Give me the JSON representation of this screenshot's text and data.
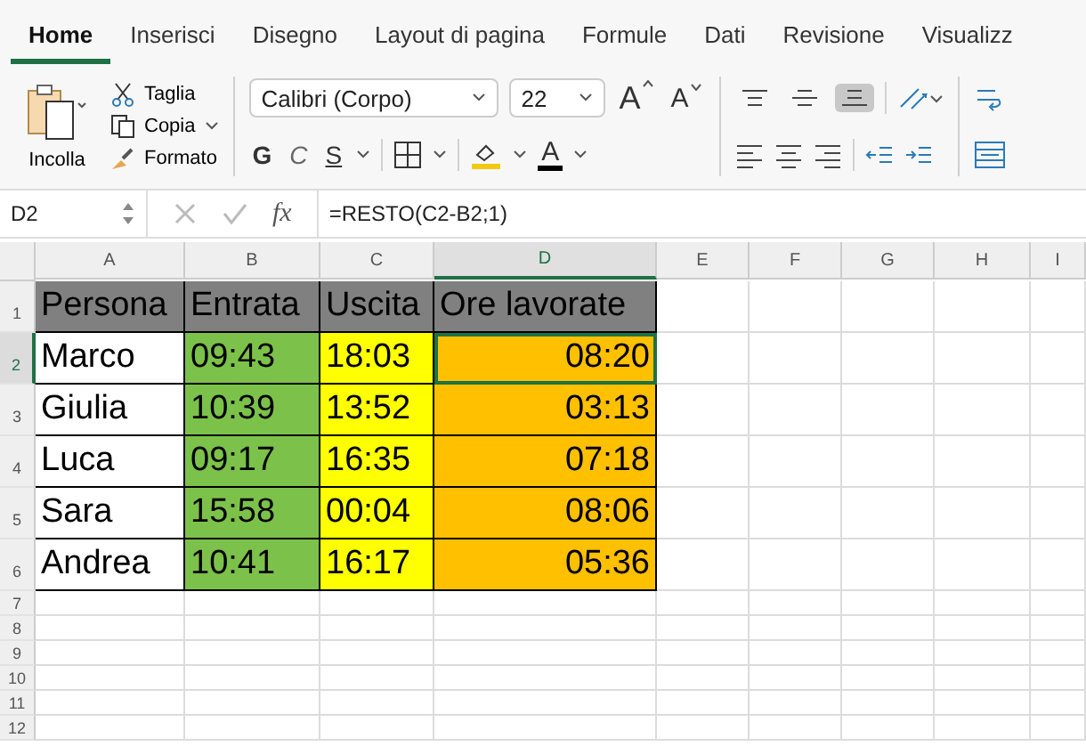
{
  "tabs": [
    {
      "label": "Home",
      "selected": true
    },
    {
      "label": "Inserisci",
      "selected": false
    },
    {
      "label": "Disegno",
      "selected": false
    },
    {
      "label": "Layout di pagina",
      "selected": false
    },
    {
      "label": "Formule",
      "selected": false
    },
    {
      "label": "Dati",
      "selected": false
    },
    {
      "label": "Revisione",
      "selected": false
    },
    {
      "label": "Visualizz",
      "selected": false
    }
  ],
  "clipboard": {
    "paste": "Incolla",
    "cut": "Taglia",
    "copy": "Copia",
    "format": "Formato"
  },
  "font": {
    "family": "Calibri (Corpo)",
    "size": "22",
    "grow": "A",
    "shrink": "A",
    "bold": "G",
    "italic": "C",
    "underline": "S",
    "font_color": "A"
  },
  "alignment": [
    {
      "kind": "top",
      "selected": false
    },
    {
      "kind": "middle",
      "selected": false
    },
    {
      "kind": "bottom",
      "selected": true
    }
  ],
  "formula_bar": {
    "name_box": "D2",
    "fx": "fx",
    "formula": "=RESTO(C2-B2;1)"
  },
  "columns": [
    {
      "letter": "A",
      "selected": false
    },
    {
      "letter": "B",
      "selected": false
    },
    {
      "letter": "C",
      "selected": false
    },
    {
      "letter": "D",
      "selected": true
    },
    {
      "letter": "E",
      "selected": false
    },
    {
      "letter": "F",
      "selected": false
    },
    {
      "letter": "G",
      "selected": false
    },
    {
      "letter": "H",
      "selected": false
    },
    {
      "letter": "I",
      "selected": false
    }
  ],
  "rows": [
    {
      "number": "1",
      "selected": false,
      "cells": [
        {
          "text": "Persona",
          "color": "#808080",
          "selected": false
        },
        {
          "text": "Entrata",
          "color": "#808080",
          "selected": false
        },
        {
          "text": "Uscita",
          "color": "#808080",
          "selected": false
        },
        {
          "text": "Ore lavorate",
          "color": "#808080",
          "selected": false
        }
      ]
    },
    {
      "number": "2",
      "selected": true,
      "cells": [
        {
          "text": "Marco",
          "color": "#ffffff",
          "selected": false
        },
        {
          "text": "09:43",
          "color": "#7cc24a",
          "selected": false
        },
        {
          "text": "18:03",
          "color": "#ffff00",
          "selected": false
        },
        {
          "text": "08:20",
          "color": "#ffc000",
          "selected": true
        }
      ]
    },
    {
      "number": "3",
      "selected": false,
      "cells": [
        {
          "text": "Giulia",
          "color": "#ffffff",
          "selected": false
        },
        {
          "text": "10:39",
          "color": "#7cc24a",
          "selected": false
        },
        {
          "text": "13:52",
          "color": "#ffff00",
          "selected": false
        },
        {
          "text": "03:13",
          "color": "#ffc000",
          "selected": false
        }
      ]
    },
    {
      "number": "4",
      "selected": false,
      "cells": [
        {
          "text": "Luca",
          "color": "#ffffff",
          "selected": false
        },
        {
          "text": "09:17",
          "color": "#7cc24a",
          "selected": false
        },
        {
          "text": "16:35",
          "color": "#ffff00",
          "selected": false
        },
        {
          "text": "07:18",
          "color": "#ffc000",
          "selected": false
        }
      ]
    },
    {
      "number": "5",
      "selected": false,
      "cells": [
        {
          "text": "Sara",
          "color": "#ffffff",
          "selected": false
        },
        {
          "text": "15:58",
          "color": "#7cc24a",
          "selected": false
        },
        {
          "text": "00:04",
          "color": "#ffff00",
          "selected": false
        },
        {
          "text": "08:06",
          "color": "#ffc000",
          "selected": false
        }
      ]
    },
    {
      "number": "6",
      "selected": false,
      "cells": [
        {
          "text": "Andrea",
          "color": "#ffffff",
          "selected": false
        },
        {
          "text": "10:41",
          "color": "#7cc24a",
          "selected": false
        },
        {
          "text": "16:17",
          "color": "#ffff00",
          "selected": false
        },
        {
          "text": "05:36",
          "color": "#ffc000",
          "selected": false
        }
      ]
    },
    {
      "number": "7",
      "selected": false,
      "cells": []
    },
    {
      "number": "8",
      "selected": false,
      "cells": []
    },
    {
      "number": "9",
      "selected": false,
      "cells": []
    },
    {
      "number": "10",
      "selected": false,
      "cells": []
    },
    {
      "number": "11",
      "selected": false,
      "cells": []
    },
    {
      "number": "12",
      "selected": false,
      "cells": []
    }
  ]
}
